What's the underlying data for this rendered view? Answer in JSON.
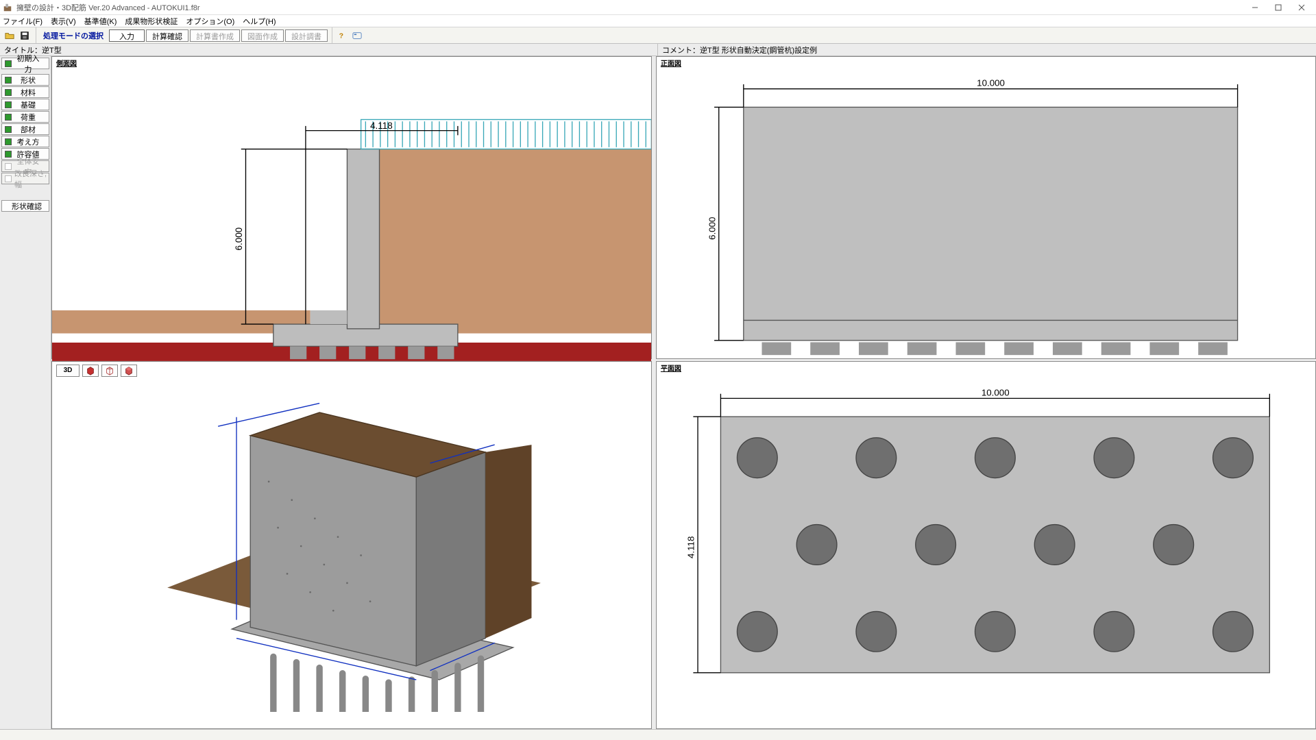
{
  "window": {
    "title": "擁壁の設計・3D配筋 Ver.20 Advanced  - AUTOKUI1.f8r"
  },
  "menu": {
    "file": "ファイル(F)",
    "view": "表示(V)",
    "reference": "基準値(K)",
    "shape_check": "成果物形状検証",
    "option": "オプション(O)",
    "help": "ヘルプ(H)"
  },
  "modebar": {
    "label": "処理モードの選択",
    "tabs": {
      "input": "入力",
      "calc_confirm": "計算確認",
      "report_create": "計算書作成",
      "drawing_create": "図面作成",
      "design_table": "設計調書"
    }
  },
  "info": {
    "title_label": "タイトル：",
    "title_value": "逆T型",
    "comment_label": "コメント：",
    "comment_value": "逆T型 形状自動決定(鋼管杭)設定例"
  },
  "sidebar": {
    "initial": "初期入力",
    "items": [
      {
        "label": "形状",
        "enabled": true
      },
      {
        "label": "材料",
        "enabled": true
      },
      {
        "label": "基礎",
        "enabled": true
      },
      {
        "label": "荷重",
        "enabled": true
      },
      {
        "label": "部材",
        "enabled": true
      },
      {
        "label": "考え方",
        "enabled": true
      },
      {
        "label": "許容値",
        "enabled": true
      },
      {
        "label": "全体安定",
        "enabled": false
      },
      {
        "label": "改良深さ,幅",
        "enabled": false
      }
    ],
    "confirm": "形状確認"
  },
  "panes": {
    "tl_label": "側面図",
    "tr_label": "正面図",
    "br_label": "平面図",
    "td_label": "3D"
  },
  "dims": {
    "len_10": "10.000",
    "h_6": "6.000",
    "w_4118": "4.118"
  }
}
